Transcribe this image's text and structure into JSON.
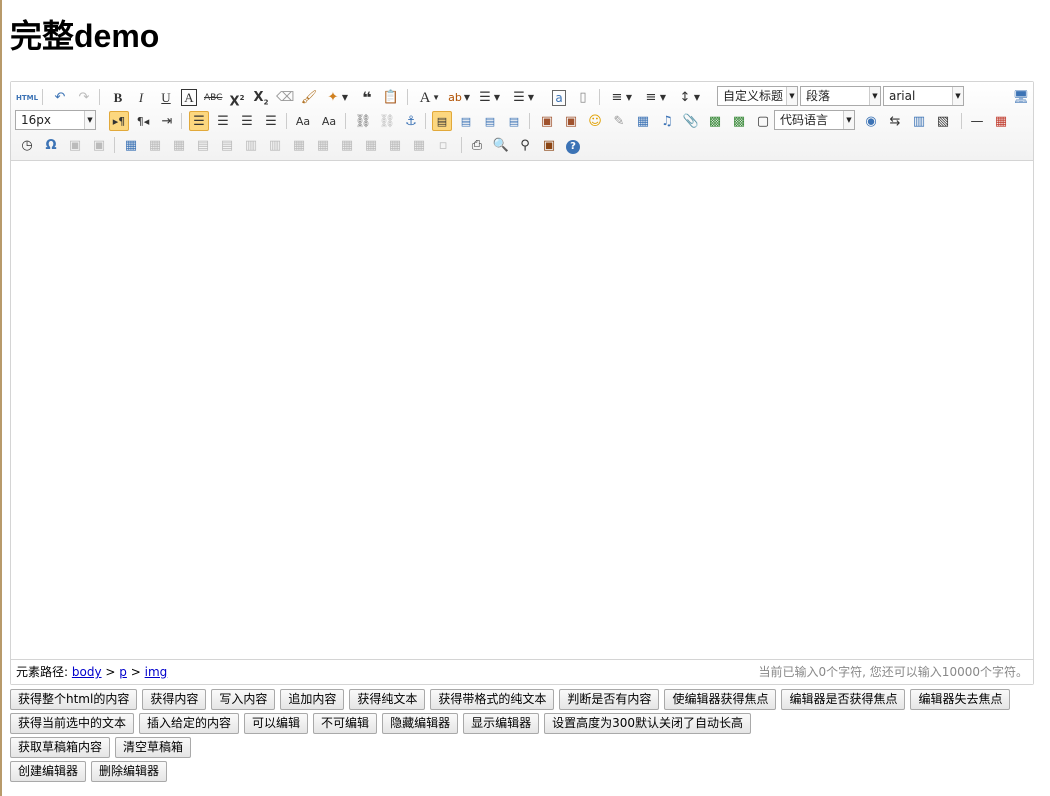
{
  "page": {
    "title": "完整demo"
  },
  "toolbar": {
    "source_label": "HTML",
    "custom_style": "自定义标题",
    "paragraph": "段落",
    "font_family": "arial",
    "font_size": "16px",
    "code_language": "代码语言"
  },
  "statusbar": {
    "path_label": "元素路径:",
    "path": [
      "body",
      "p",
      "img"
    ],
    "separator": ">",
    "wordcount": "当前已输入0个字符, 您还可以输入10000个字符。"
  },
  "buttons": {
    "row1": [
      "获得整个html的内容",
      "获得内容",
      "写入内容",
      "追加内容",
      "获得纯文本",
      "获得带格式的纯文本",
      "判断是否有内容",
      "使编辑器获得焦点",
      "编辑器是否获得焦点",
      "编辑器失去焦点"
    ],
    "row2": [
      "获得当前选中的文本",
      "插入给定的内容",
      "可以编辑",
      "不可编辑",
      "隐藏编辑器",
      "显示编辑器",
      "设置高度为300默认关闭了自动长高"
    ],
    "row3": [
      "获取草稿箱内容",
      "清空草稿箱"
    ],
    "row4": [
      "创建编辑器",
      "删除编辑器"
    ]
  },
  "icons": {
    "row1": [
      "source-icon",
      "undo-icon",
      "redo-icon",
      "bold-icon",
      "italic-icon",
      "underline-icon",
      "font-border-icon",
      "strikethrough-icon",
      "superscript-icon",
      "subscript-icon",
      "remove-format-icon",
      "format-match-icon",
      "auto-typeset-icon",
      "blockquote-icon",
      "paste-plain-icon",
      "font-color-icon",
      "background-color-icon",
      "ordered-list-icon",
      "unordered-list-icon",
      "select-all-icon",
      "clear-doc-icon",
      "row-spacing-top-icon",
      "row-spacing-bottom-icon",
      "line-height-icon",
      "fullscreen-icon"
    ],
    "row2": [
      "ltr-icon",
      "rtl-icon",
      "indent-icon",
      "align-left-icon",
      "align-center-icon",
      "align-right-icon",
      "align-justify-icon",
      "to-uppercase-icon",
      "to-lowercase-icon",
      "link-icon",
      "unlink-icon",
      "anchor-icon",
      "image-none-icon",
      "image-left-icon",
      "image-right-icon",
      "image-center-icon",
      "simple-upload-icon",
      "insert-image-icon",
      "emotion-icon",
      "scrawl-icon",
      "insert-video-icon",
      "music-icon",
      "attachment-icon",
      "map-icon",
      "gmap-icon",
      "insert-frame-icon",
      "insert-code-icon",
      "page-break-icon",
      "template-icon",
      "background-icon",
      "horizontal-icon",
      "date-icon"
    ],
    "row3": [
      "time-icon",
      "special-chars-icon",
      "snap-screen-icon",
      "word-image-icon",
      "insert-table-icon",
      "delete-table-icon",
      "insert-paragraph-before-table-icon",
      "insert-row-icon",
      "delete-row-icon",
      "insert-col-icon",
      "delete-col-icon",
      "merge-cells-icon",
      "merge-right-icon",
      "merge-down-icon",
      "split-to-cells-icon",
      "split-to-rows-icon",
      "split-to-cols-icon",
      "charts-icon",
      "print-icon",
      "preview-icon",
      "search-replace-icon",
      "drafts-icon",
      "help-icon"
    ]
  }
}
